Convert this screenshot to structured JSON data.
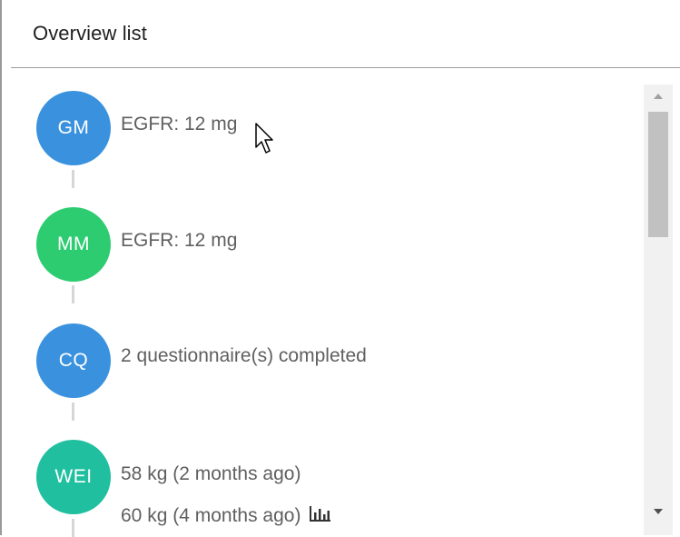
{
  "panel": {
    "title": "Overview list"
  },
  "items": [
    {
      "initials": "GM",
      "color": "#3a92de",
      "lines": [
        "EGFR: 12 mg"
      ]
    },
    {
      "initials": "MM",
      "color": "#2ecc71",
      "lines": [
        "EGFR: 12 mg"
      ]
    },
    {
      "initials": "CQ",
      "color": "#3a92de",
      "lines": [
        "2 questionnaire(s) completed"
      ]
    },
    {
      "initials": "WEI",
      "color": "#1fbf9f",
      "lines": [
        "58 kg (2 months ago)",
        "60 kg (4 months ago)"
      ]
    }
  ],
  "icons": {
    "trend": "bar-chart-icon",
    "scroll_up": "chevron-up-icon",
    "scroll_down": "chevron-down-icon",
    "cursor": "mouse-pointer-icon"
  }
}
